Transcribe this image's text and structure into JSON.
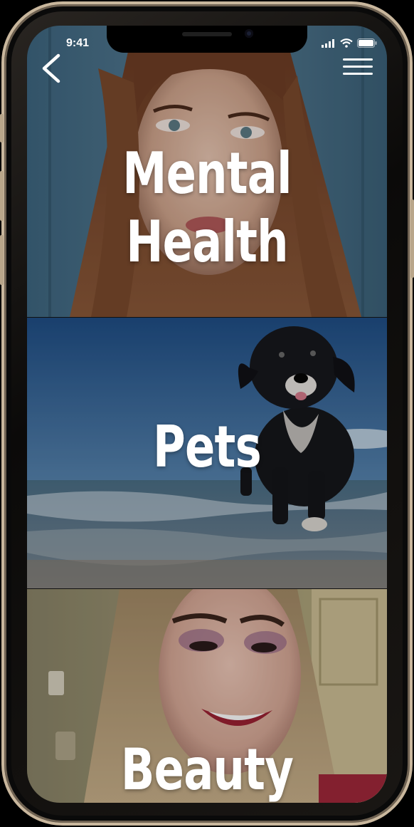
{
  "status_bar": {
    "time": "9:41",
    "signal_icon": "signal-bars-icon",
    "wifi_icon": "wifi-icon",
    "battery_icon": "battery-icon"
  },
  "nav": {
    "back_icon": "chevron-left-icon",
    "menu_icon": "hamburger-menu-icon"
  },
  "categories": [
    {
      "label": "Mental Health",
      "image": "woman-portrait-photo"
    },
    {
      "label": "Pets",
      "image": "dog-on-beach-photo"
    },
    {
      "label": "Beauty",
      "image": "smiling-woman-makeup-photo"
    }
  ],
  "colors": {
    "frame_gold": "#c9b79d",
    "label_text": "#ffffff"
  }
}
